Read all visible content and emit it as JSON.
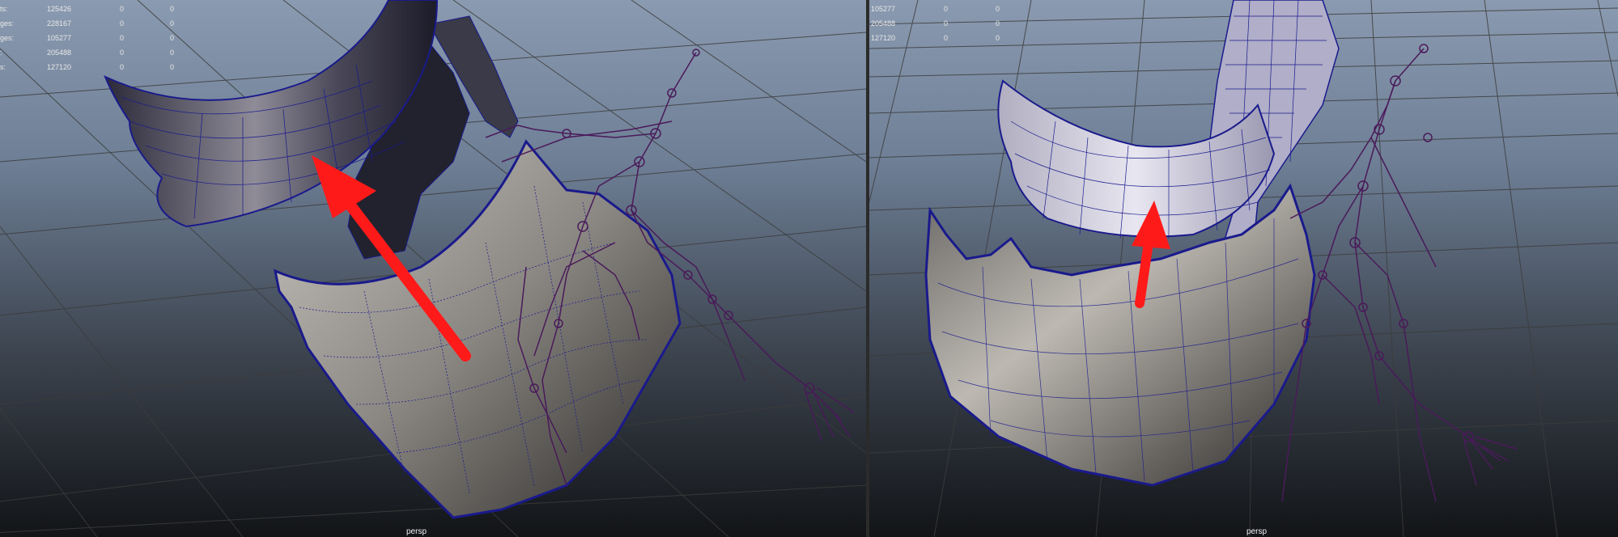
{
  "viewports": [
    {
      "camera": "persp",
      "hud": [
        {
          "label": "ts:",
          "values": [
            "125426",
            "0",
            "0"
          ]
        },
        {
          "label": "ges:",
          "values": [
            "228167",
            "0",
            "0"
          ]
        },
        {
          "label": "ges:",
          "values": [
            "105277",
            "0",
            "0"
          ]
        },
        {
          "label": ":",
          "values": [
            "205488",
            "0",
            "0"
          ]
        },
        {
          "label": "s:",
          "values": [
            "127120",
            "0",
            "0"
          ]
        }
      ]
    },
    {
      "camera": "persp",
      "hud": [
        {
          "values": [
            "105277",
            "0",
            "0"
          ]
        },
        {
          "values": [
            "205488",
            "0",
            "0"
          ]
        },
        {
          "values": [
            "127120",
            "0",
            "0"
          ]
        }
      ]
    }
  ],
  "colors": {
    "annotation_arrow": "#ff1a1a",
    "wireframe": "#1a1a8c",
    "skeleton": "#4a1a5a",
    "grid": "#3c3c3c"
  }
}
